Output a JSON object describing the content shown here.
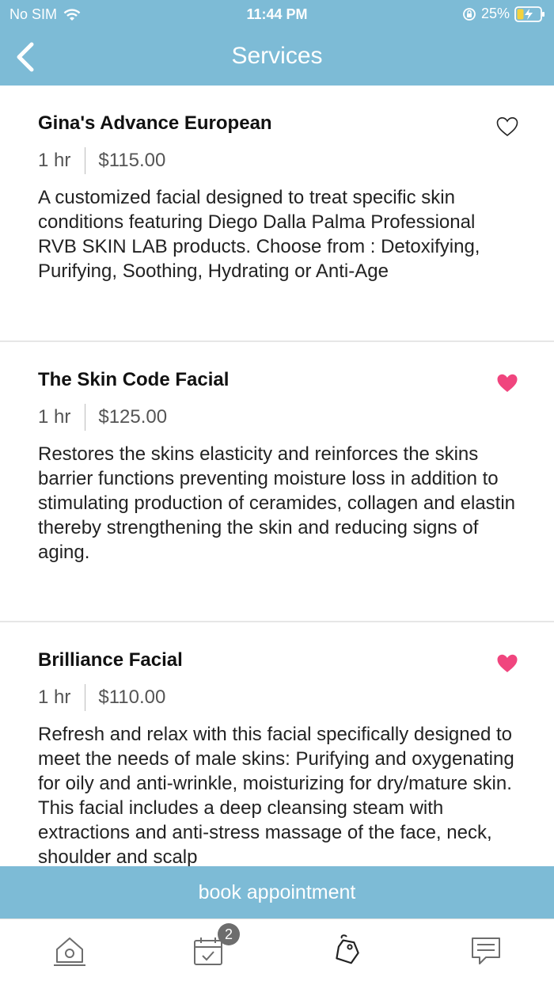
{
  "status_bar": {
    "carrier": "No SIM",
    "time": "11:44 PM",
    "battery": "25%"
  },
  "nav": {
    "title": "Services"
  },
  "services": [
    {
      "name": "Gina's Advance European",
      "duration": "1 hr",
      "price": "$115.00",
      "description": "A customized facial designed to treat specific skin conditions featuring Diego Dalla Palma Professional RVB SKIN LAB products. Choose from : Detoxifying, Purifying, Soothing, Hydrating or Anti-Age",
      "favorited": false
    },
    {
      "name": "The Skin Code Facial",
      "duration": "1 hr",
      "price": "$125.00",
      "description": "Restores the skins elasticity and reinforces the skins barrier functions preventing moisture loss in addition to stimulating production of ceramides, collagen and elastin thereby strengthening the skin and reducing signs of aging.",
      "favorited": true
    },
    {
      "name": "Brilliance Facial",
      "duration": "1 hr",
      "price": "$110.00",
      "description": "Refresh and relax with this facial specifically designed to meet the needs of male skins: Purifying and oxygenating for oily and anti-wrinkle, moisturizing for dry/mature skin. This facial includes a deep cleansing steam with extractions and anti-stress massage of the face, neck, shoulder and scalp",
      "favorited": true
    }
  ],
  "book_button": {
    "label": "book appointment"
  },
  "tabbar": {
    "appointments_badge": "2",
    "tabs": [
      "home-icon",
      "calendar-icon",
      "tags-icon",
      "chat-icon"
    ]
  },
  "colors": {
    "accent": "#7dbbd6",
    "favorite": "#f0457e"
  }
}
